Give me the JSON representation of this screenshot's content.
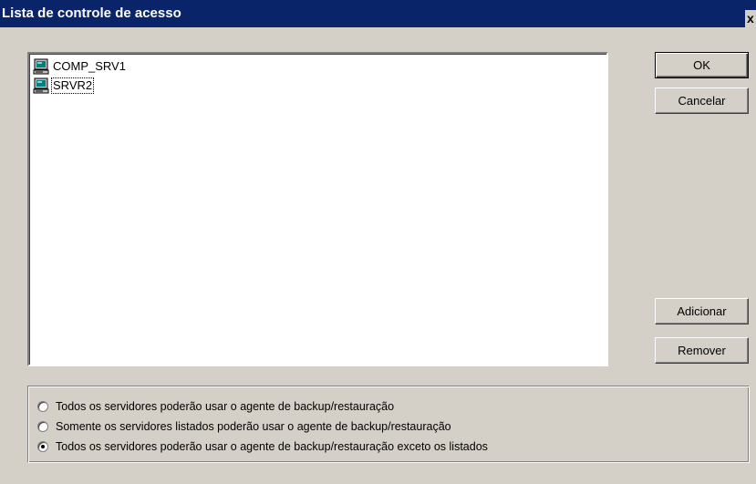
{
  "window": {
    "title": "Lista de controle de acesso",
    "close_label": "x"
  },
  "server_list": {
    "items": [
      {
        "label": "COMP_SRV1",
        "icon": "computer-icon"
      },
      {
        "label": "SRVR2",
        "icon": "computer-icon",
        "focused": true
      }
    ]
  },
  "buttons": {
    "ok": "OK",
    "cancel": "Cancelar",
    "add": "Adicionar",
    "remove": "Remover"
  },
  "access_options": {
    "selected_index": 2,
    "options": [
      "Todos os servidores poderão usar o agente de backup/restauração",
      "Somente os servidores listados poderão usar o agente de backup/restauração",
      "Todos os servidores poderão usar o agente de backup/restauração exceto os listados"
    ]
  },
  "colors": {
    "titlebar": "#0a246a",
    "face": "#d4d0c8"
  }
}
